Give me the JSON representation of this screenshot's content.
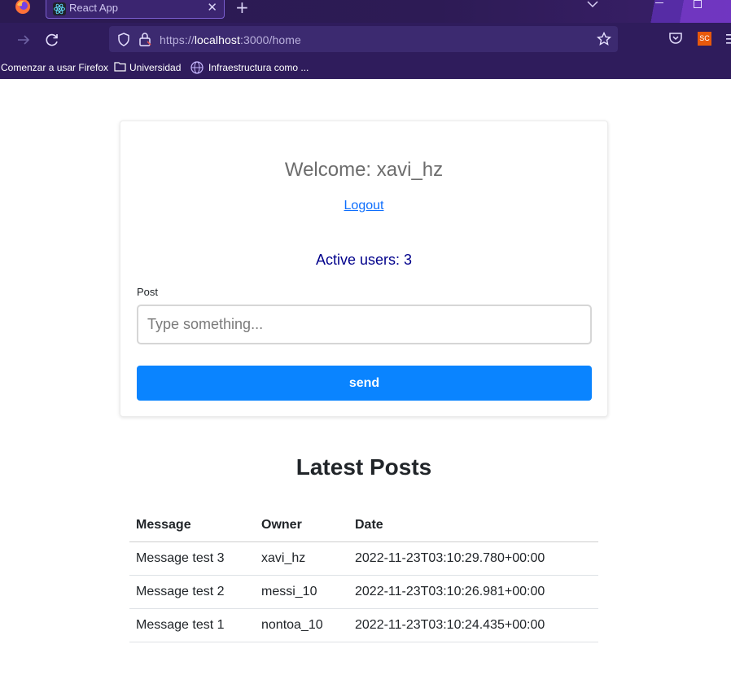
{
  "browser": {
    "tab_title": "React App",
    "url_prefix": "https://",
    "url_host": "localhost",
    "url_rest": ":3000/home",
    "extension_badge": "SC",
    "bookmarks": [
      "Comenzar a usar Firefox",
      "Universidad",
      "Infraestructura como ..."
    ]
  },
  "page": {
    "welcome": "Welcome: xavi_hz",
    "logout_label": "Logout",
    "active_users": "Active users: 3",
    "post_label": "Post",
    "post_placeholder": "Type something...",
    "post_value": "",
    "send_label": "send"
  },
  "posts": {
    "title": "Latest Posts",
    "columns": [
      "Message",
      "Owner",
      "Date"
    ],
    "rows": [
      [
        "Message test 3",
        "xavi_hz",
        "2022-11-23T03:10:29.780+00:00"
      ],
      [
        "Message test 2",
        "messi_10",
        "2022-11-23T03:10:26.981+00:00"
      ],
      [
        "Message test 1",
        "nontoa_10",
        "2022-11-23T03:10:24.435+00:00"
      ]
    ]
  },
  "colors": {
    "accent": "#0a84ff",
    "link": "#0d6efd",
    "active_users": "#00008b",
    "browser_chrome": "#2f1c5c"
  }
}
